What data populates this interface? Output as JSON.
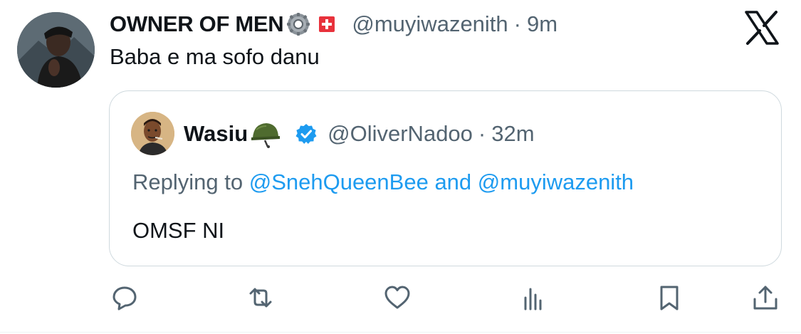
{
  "post": {
    "author": {
      "display_name": "OWNER OF MEN",
      "badges": [
        "gear-icon",
        "swiss-flag-icon"
      ],
      "handle": "@muyiwazenith",
      "separator": "·",
      "time": "9m"
    },
    "text": "Baba e ma sofo danu",
    "platform_logo": "x-logo-icon"
  },
  "quoted_post": {
    "author": {
      "display_name": "Wasiu",
      "badges": [
        "military-helmet-icon",
        "verified-badge-icon"
      ],
      "handle": "@OliverNadoo",
      "separator": "·",
      "time": "32m"
    },
    "replying": {
      "prefix": "Replying to ",
      "mention_1": "@SnehQueenBee",
      "conjunction": " and ",
      "mention_2": "@muyiwazenith"
    },
    "text": "OMSF NI"
  },
  "actions": [
    {
      "name": "reply-button",
      "icon": "comment-icon"
    },
    {
      "name": "repost-button",
      "icon": "repost-icon"
    },
    {
      "name": "like-button",
      "icon": "heart-icon"
    },
    {
      "name": "views-button",
      "icon": "views-chart-icon"
    },
    {
      "name": "bookmark-button",
      "icon": "bookmark-icon"
    },
    {
      "name": "share-button",
      "icon": "share-icon"
    }
  ],
  "colors": {
    "text": "#0f1419",
    "secondary": "#536471",
    "link": "#1d9bf0",
    "border": "#cfd9de",
    "verified": "#1d9bf0"
  }
}
